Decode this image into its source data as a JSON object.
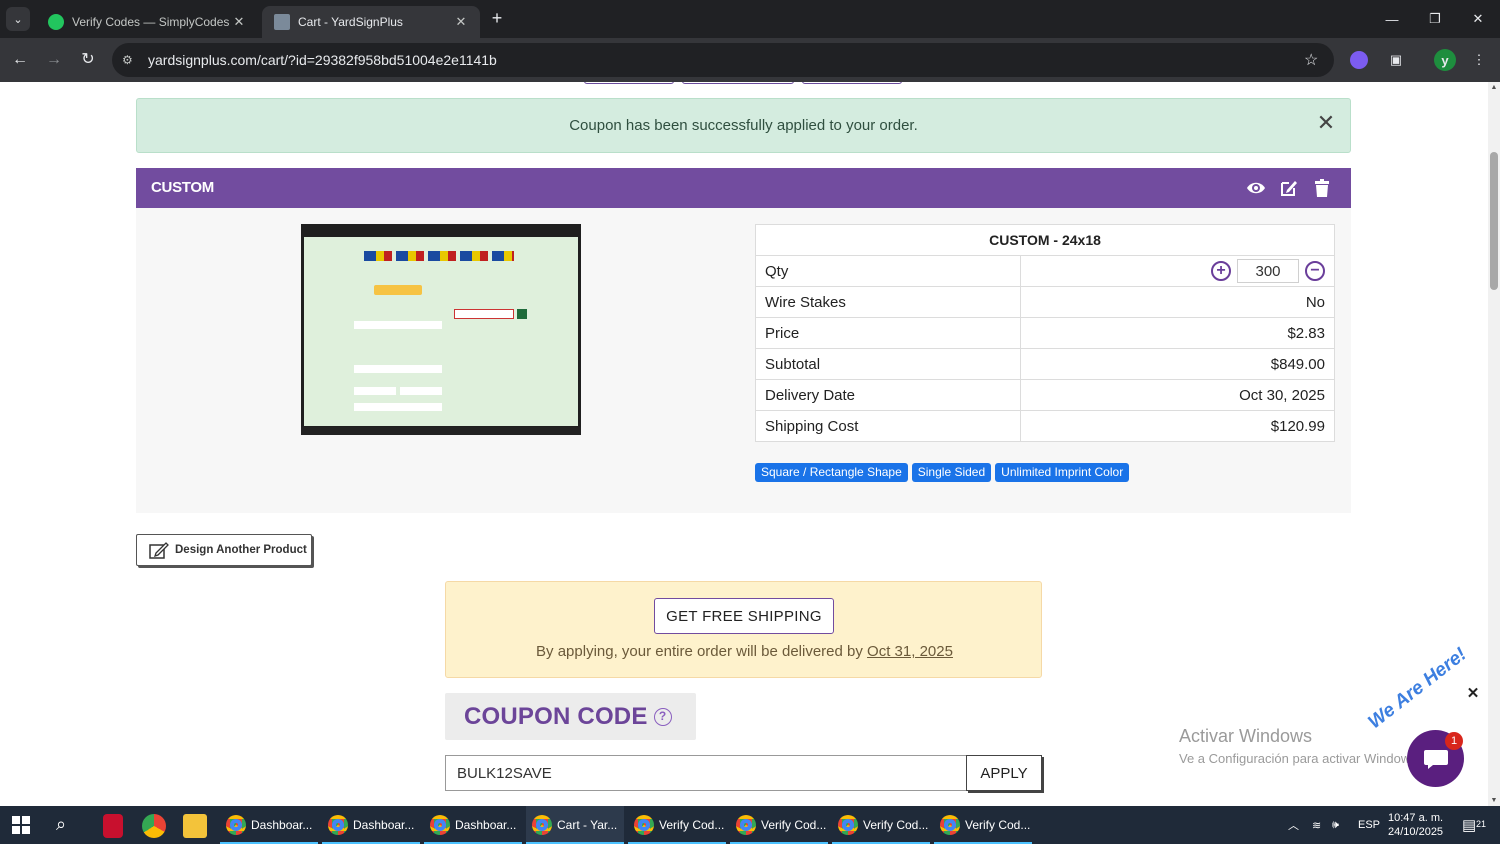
{
  "browser": {
    "tabs": [
      {
        "title": "Verify Codes — SimplyCodes",
        "active": false
      },
      {
        "title": "Cart - YardSignPlus",
        "active": true
      }
    ],
    "url": "yardsignplus.com/cart/?id=29382f958bd51004e2e1141b",
    "profile_initial": "y"
  },
  "alert": {
    "message": "Coupon has been successfully applied to your order."
  },
  "cart_item": {
    "header": "CUSTOM",
    "table_title": "CUSTOM - 24x18",
    "rows": [
      {
        "label": "Qty",
        "value": "300"
      },
      {
        "label": "Wire Stakes",
        "value": "No"
      },
      {
        "label": "Price",
        "value": "$2.83"
      },
      {
        "label": "Subtotal",
        "value": "$849.00"
      },
      {
        "label": "Delivery Date",
        "value": "Oct 30, 2025"
      },
      {
        "label": "Shipping Cost",
        "value": "$120.99"
      }
    ],
    "tags": [
      "Square / Rectangle Shape",
      "Single Sided",
      "Unlimited Imprint Color"
    ]
  },
  "design_button": "Design Another Product",
  "shipping": {
    "button": "GET FREE SHIPPING",
    "text_prefix": "By applying, your entire order will be delivered by",
    "date": "Oct 31, 2025"
  },
  "coupon": {
    "heading": "COUPON CODE",
    "value": "BULK12SAVE",
    "apply": "APPLY"
  },
  "windows_watermark": {
    "line1": "Activar Windows",
    "line2": "Ve a Configuración para activar Windows."
  },
  "chat": {
    "label": "We Are Here!",
    "badge": "1"
  },
  "taskbar": {
    "apps": [
      "Dashboar...",
      "Dashboar...",
      "Dashboar...",
      "Cart - Yar...",
      "Verify Cod...",
      "Verify Cod...",
      "Verify Cod...",
      "Verify Cod..."
    ],
    "language": "ESP",
    "time": "10:47 a. m.",
    "date": "24/10/2025",
    "notifications": "21"
  },
  "colors": {
    "brand_purple": "#724c9f",
    "alert_bg": "#d4ecdf",
    "tag_blue": "#1a73e8",
    "shipping_bg": "#fef2cc"
  }
}
